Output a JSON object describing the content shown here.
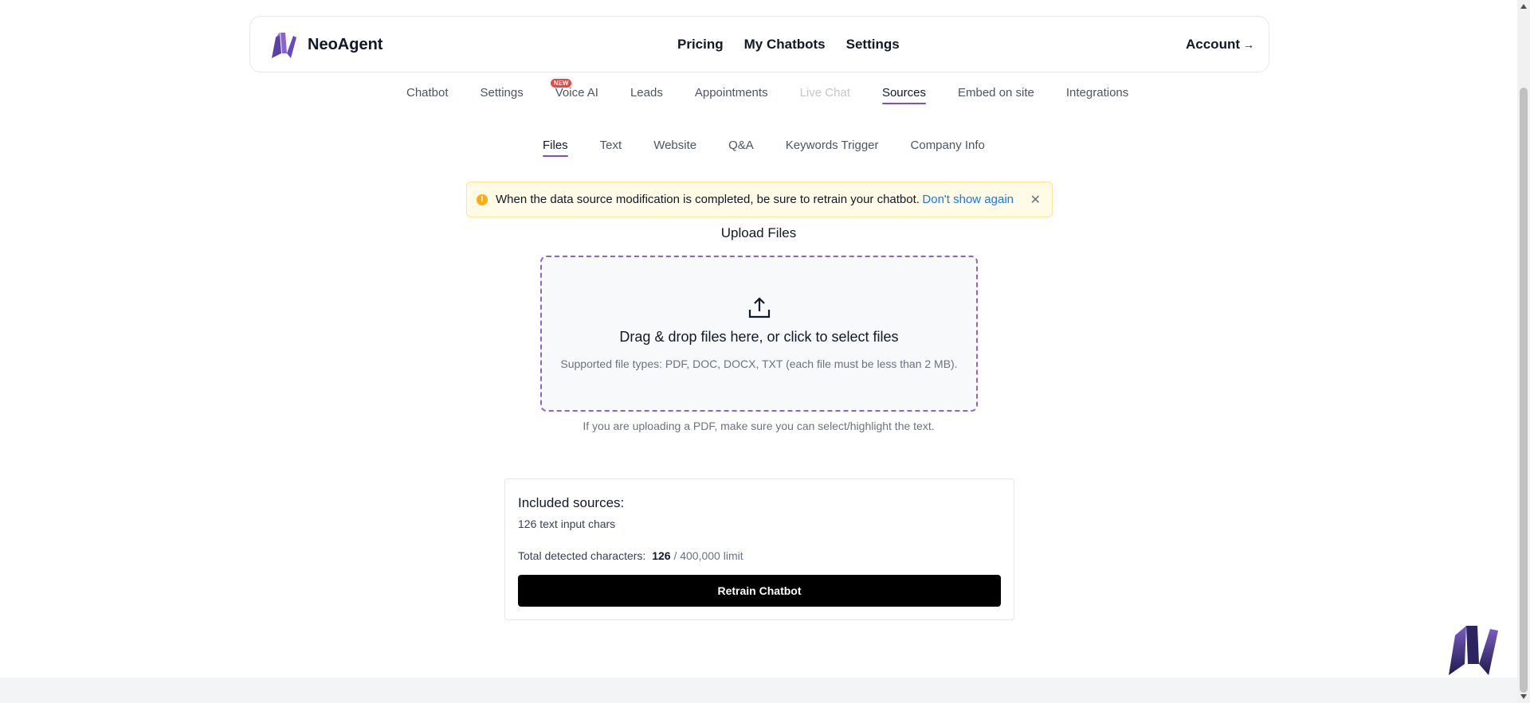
{
  "brand": {
    "name": "NeoAgent",
    "icon": "neoagent-logo"
  },
  "top_nav": {
    "items": [
      "Pricing",
      "My Chatbots",
      "Settings"
    ],
    "account_label": "Account",
    "account_arrow": "→"
  },
  "main_tabs": {
    "items": [
      {
        "label": "Chatbot",
        "state": "normal"
      },
      {
        "label": "Settings",
        "state": "normal"
      },
      {
        "label": "Voice AI",
        "state": "normal",
        "badge": "NEW"
      },
      {
        "label": "Leads",
        "state": "normal"
      },
      {
        "label": "Appointments",
        "state": "normal"
      },
      {
        "label": "Live Chat",
        "state": "disabled"
      },
      {
        "label": "Sources",
        "state": "active"
      },
      {
        "label": "Embed on site",
        "state": "normal"
      },
      {
        "label": "Integrations",
        "state": "normal"
      }
    ]
  },
  "sub_tabs": {
    "items": [
      {
        "label": "Files",
        "active": true
      },
      {
        "label": "Text",
        "active": false
      },
      {
        "label": "Website",
        "active": false
      },
      {
        "label": "Q&A",
        "active": false
      },
      {
        "label": "Keywords Trigger",
        "active": false
      },
      {
        "label": "Company Info",
        "active": false
      }
    ]
  },
  "alert": {
    "icon": "warning-icon",
    "message": "When the data source modification is completed, be sure to retrain your chatbot.",
    "dont_show_label": "Don't show again",
    "close_icon": "close-icon"
  },
  "upload": {
    "title": "Upload Files",
    "icon": "upload-icon",
    "drop_text": "Drag & drop files here, or click to select files",
    "supported_types": "Supported file types: PDF, DOC, DOCX, TXT (each file must be less than 2 MB).",
    "pdf_note": "If you are uploading a PDF, make sure you can select/highlight the text."
  },
  "sources_summary": {
    "heading": "Included sources:",
    "chars_line": "126 text input chars",
    "total_label": "Total detected characters:",
    "total_count": "126",
    "limit_text": "/ 400,000 limit",
    "retrain_label": "Retrain Chatbot"
  },
  "colors": {
    "accent": "#7c4dcc",
    "alert_bg": "#fffbe6",
    "alert_border": "#ffe58f",
    "link": "#1677ff",
    "button_bg": "#000000"
  }
}
